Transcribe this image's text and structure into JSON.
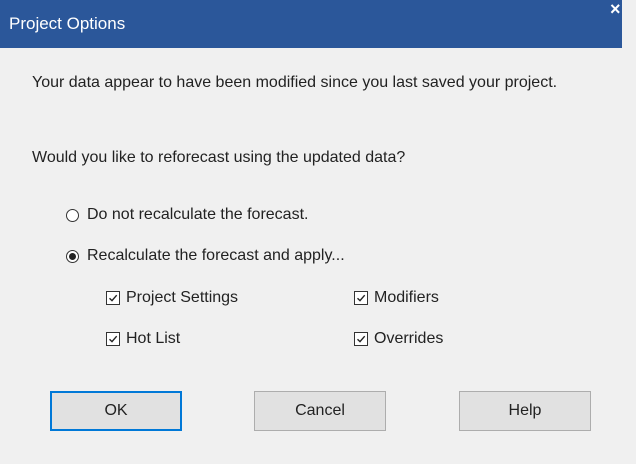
{
  "window": {
    "title": "Project Options",
    "close_glyph": "×"
  },
  "message": {
    "line1": "Your data appear to have been modified since you last saved your project.",
    "line2": "Would you like to reforecast using the updated data?"
  },
  "options": {
    "radio_no_recalc": {
      "label": "Do not recalculate the forecast.",
      "selected": false
    },
    "radio_recalc": {
      "label": "Recalculate the forecast and apply...",
      "selected": true
    }
  },
  "apply_items": {
    "project_settings": {
      "label": "Project Settings",
      "checked": true
    },
    "modifiers": {
      "label": "Modifiers",
      "checked": true
    },
    "hot_list": {
      "label": "Hot List",
      "checked": true
    },
    "overrides": {
      "label": "Overrides",
      "checked": true
    }
  },
  "buttons": {
    "ok": "OK",
    "cancel": "Cancel",
    "help": "Help"
  },
  "colors": {
    "title_bar": "#2b579a",
    "background": "#f0f0f0",
    "default_button_border": "#0078d7"
  }
}
